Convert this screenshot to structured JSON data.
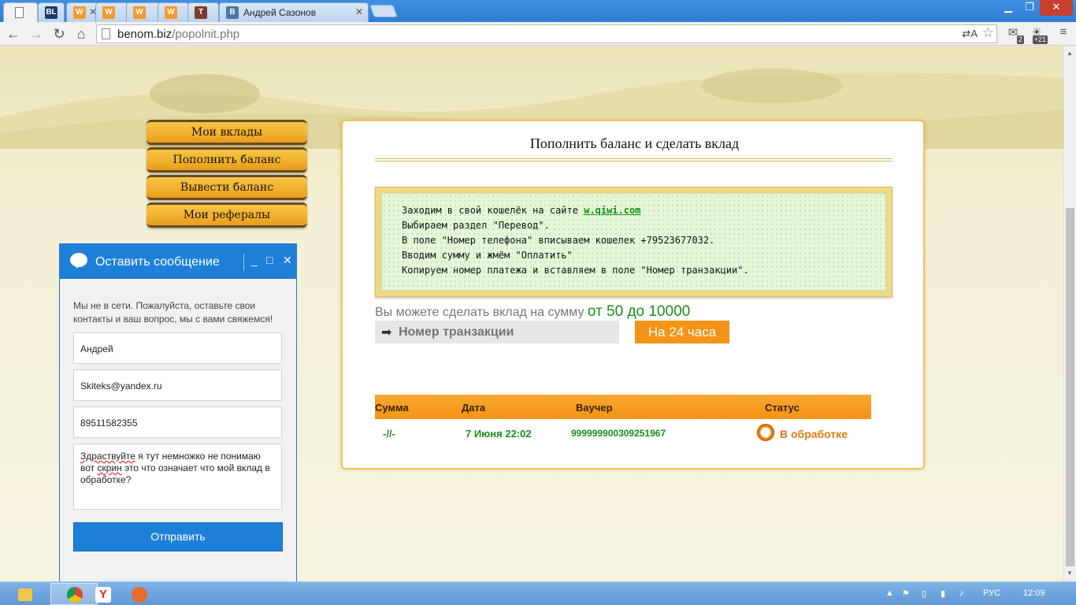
{
  "browser": {
    "tabs": [
      {
        "title": "",
        "favicon": "page-icon",
        "active": true
      },
      {
        "title": "",
        "favicon": "BL"
      },
      {
        "title": "",
        "favicon": "W"
      },
      {
        "title": "",
        "favicon": "W"
      },
      {
        "title": "",
        "favicon": "W"
      },
      {
        "title": "",
        "favicon": "W"
      },
      {
        "title": "",
        "favicon": "T"
      },
      {
        "title": "Андрей Сазонов",
        "favicon": "B"
      }
    ],
    "url_host": "benom.biz",
    "url_path": "/popolnit.php",
    "extensions": [
      {
        "icon": "mail-icon",
        "badge": "2"
      },
      {
        "icon": "weather-icon",
        "badge": "+21"
      }
    ]
  },
  "menu": {
    "items": [
      "Мои вклады",
      "Пополнить баланс",
      "Вывести баланс",
      "Мои рефералы"
    ]
  },
  "panel": {
    "title": "Пополнить баланс и сделать вклад",
    "instructions": {
      "line1_prefix": "Заходим в свой кошелёк на сайте ",
      "line1_link": "w.qiwi.com",
      "line2": "Выбираем раздел \"Перевод\".",
      "line3": "В поле \"Номер телефона\" вписываем кошелек +79523677032.",
      "line4": "Вводим сумму и жмём \"Оплатить\"",
      "line5": "Копируем номер платежа и вставляем в поле \"Номер транзакции\"."
    },
    "sum_text": "Вы можете сделать вклад на сумму",
    "sum_range": "от 50 до 10000",
    "tx_placeholder": "Номер транзакции",
    "submit_label": "На 24 часа",
    "table": {
      "headers": [
        "Сумма",
        "Дата",
        "Ваучер",
        "Статус"
      ],
      "row": {
        "sum": "-//-",
        "date": "7 Июня 22:02",
        "voucher": "999999900309251967",
        "status": "В обработке"
      }
    }
  },
  "chat": {
    "title": "Оставить сообщение",
    "offline_msg": "Мы не в сети. Пожалуйста, оставьте свои контакты и ваш вопрос, мы с вами свяжемся!",
    "name_value": "Андрей",
    "email_value": "Skiteks@yandex.ru",
    "phone_value": "89511582355",
    "message_w1": "Здраствуйте",
    "message_mid1": " я тут немножко не понимаю вот ",
    "message_w2": "скрин",
    "message_rest": " это что означает что мой вклад в обработке?",
    "send_label": "Отправить"
  },
  "taskbar": {
    "lang": "РУС",
    "time": "12:09"
  },
  "colors": {
    "accent_orange": "#f39417",
    "chat_blue": "#1e7fd9",
    "success_green": "#1c8b1c"
  }
}
